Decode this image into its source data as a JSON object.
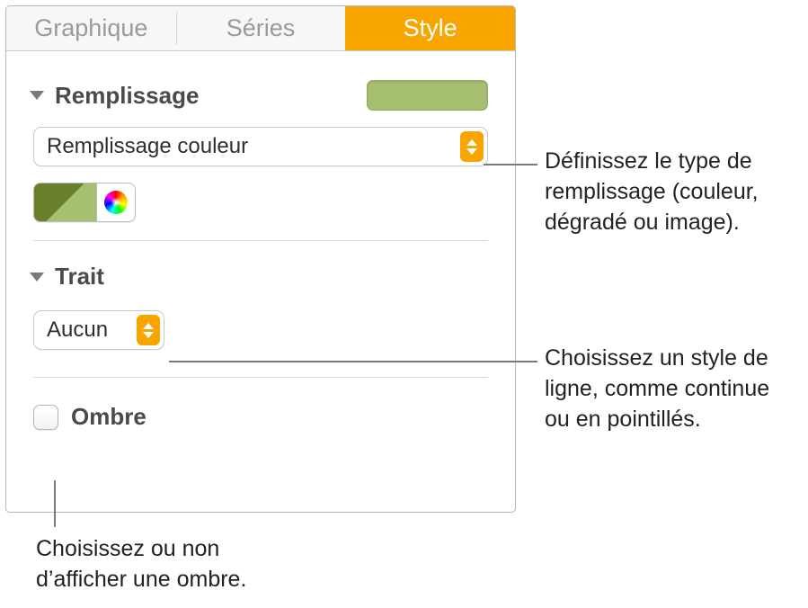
{
  "tabs": {
    "chart": "Graphique",
    "series": "Séries",
    "style": "Style"
  },
  "fill": {
    "section_label": "Remplissage",
    "swatch_color": "#a6bf71",
    "type_label": "Remplissage couleur"
  },
  "stroke": {
    "section_label": "Trait",
    "type_label": "Aucun"
  },
  "shadow": {
    "label": "Ombre"
  },
  "callouts": {
    "fill": "Définissez le type de remplissage (couleur, dégradé ou image).",
    "stroke": "Choisissez un style de ligne, comme continue ou en pointillés.",
    "shadow": "Choisissez ou non d’afficher une ombre."
  }
}
